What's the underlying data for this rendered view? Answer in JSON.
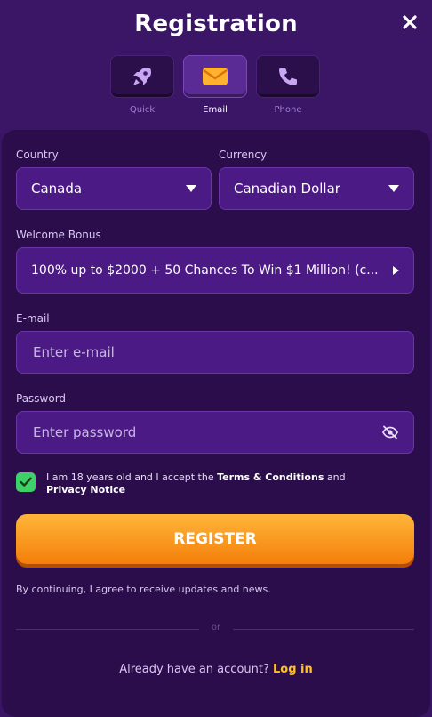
{
  "header": {
    "title": "Registration"
  },
  "tabs": [
    {
      "label": "Quick",
      "icon": "rocket-icon"
    },
    {
      "label": "Email",
      "icon": "envelope-icon",
      "active": true
    },
    {
      "label": "Phone",
      "icon": "phone-icon"
    }
  ],
  "form": {
    "country_label": "Country",
    "country_value": "Canada",
    "currency_label": "Currency",
    "currency_value": "Canadian Dollar",
    "bonus_label": "Welcome Bonus",
    "bonus_value": "100% up to $2000 + 50 Chances To Win $1 Million! (c...",
    "email_label": "E-mail",
    "email_placeholder": "Enter e-mail",
    "password_label": "Password",
    "password_placeholder": "Enter password"
  },
  "consent": {
    "checked": true,
    "prefix": "I am 18 years old and I accept the ",
    "terms_link": "Terms & Conditions",
    "middle": " and ",
    "privacy_link": "Privacy Notice"
  },
  "register_label": "REGISTER",
  "updates_note": "By continuing, I agree to receive updates and news.",
  "divider_text": "or",
  "login": {
    "prompt": "Already have an account?",
    "link": "Log in"
  },
  "colors": {
    "background": "#3a1464",
    "panel": "#2b0d4c",
    "field": "#4c1a85",
    "accent_orange": "#f47f0a",
    "link_yellow": "#ffc21e",
    "check_green": "#3fd06a"
  }
}
